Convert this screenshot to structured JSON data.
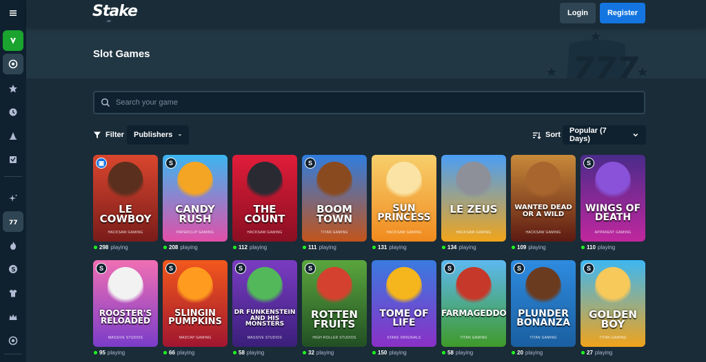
{
  "header": {
    "logo": "Stake",
    "logo_sub": ".us",
    "login_label": "Login",
    "register_label": "Register"
  },
  "sidebar": {
    "items": [
      {
        "icon": "menu-icon"
      },
      {
        "icon": "sweepstakes-icon"
      },
      {
        "icon": "casino-chip-icon"
      },
      {
        "icon": "star-icon"
      },
      {
        "icon": "clock-icon"
      },
      {
        "icon": "trophy-cone-icon"
      },
      {
        "icon": "checklist-icon"
      },
      {
        "icon": "sparkle-icon"
      },
      {
        "icon": "slots-777-icon"
      },
      {
        "icon": "fire-icon"
      },
      {
        "icon": "stake-originals-icon"
      },
      {
        "icon": "shirt-icon"
      },
      {
        "icon": "crown-icon"
      },
      {
        "icon": "live-casino-icon"
      }
    ]
  },
  "banner": {
    "title": "Slot Games"
  },
  "search": {
    "placeholder": "Search your game"
  },
  "filters": {
    "filter_label": "Filter",
    "publishers_label": "Publishers",
    "sort_label": "Sort",
    "sort_value": "Popular (7 Days)"
  },
  "games": [
    {
      "title": "LE COWBOY",
      "publisher": "HACKSAW GAMING",
      "playing": "298",
      "badge": "lock",
      "bg_top": "#d9462e",
      "bg_bottom": "#7a1c1a",
      "accent": "#5b2f1d",
      "title_size": 15
    },
    {
      "title": "CANDY RUSH",
      "publisher": "PAPERCLIP GAMING",
      "playing": "208",
      "badge": "S",
      "bg_top": "#3cb6f0",
      "bg_bottom": "#e24fa8",
      "accent": "#f5a524",
      "title_size": 15
    },
    {
      "title": "THE COUNT",
      "publisher": "HACKSAW GAMING",
      "playing": "112",
      "badge": "",
      "bg_top": "#e11d3a",
      "bg_bottom": "#8a0f22",
      "accent": "#2a2a33",
      "title_size": 15
    },
    {
      "title": "BOOM TOWN",
      "publisher": "TITAN GAMING",
      "playing": "111",
      "badge": "S",
      "bg_top": "#2f7de0",
      "bg_bottom": "#c2541b",
      "accent": "#8a4a1f",
      "title_size": 15
    },
    {
      "title": "SUN PRINCESS",
      "publisher": "HACKSAW GAMING",
      "playing": "131",
      "badge": "",
      "bg_top": "#f7cf6b",
      "bg_bottom": "#f08a1e",
      "accent": "#fbe3a5",
      "title_size": 14
    },
    {
      "title": "LE ZEUS",
      "publisher": "HACKSAW GAMING",
      "playing": "134",
      "badge": "",
      "bg_top": "#4a9ef5",
      "bg_bottom": "#f1a51a",
      "accent": "#8d8f99",
      "title_size": 15
    },
    {
      "title": "WANTED DEAD OR A WILD",
      "publisher": "HACKSAW GAMING",
      "playing": "109",
      "badge": "",
      "bg_top": "#c88a3a",
      "bg_bottom": "#5d1a12",
      "accent": "#a8652e",
      "title_size": 10
    },
    {
      "title": "WINGS OF DEATH",
      "publisher": "APPARENT GAMING",
      "playing": "110",
      "badge": "S",
      "bg_top": "#4a2b8a",
      "bg_bottom": "#c0279e",
      "accent": "#8a52d8",
      "title_size": 14
    },
    {
      "title": "ROOSTER'S RELOADED",
      "publisher": "MASSIVE STUDIOS",
      "playing": "95",
      "badge": "S",
      "bg_top": "#f06fb3",
      "bg_bottom": "#7b3cc9",
      "accent": "#f2f2f2",
      "title_size": 12
    },
    {
      "title": "SLINGIN PUMPKINS",
      "publisher": "MADCAP GAMING",
      "playing": "66",
      "badge": "S",
      "bg_top": "#f2581c",
      "bg_bottom": "#a01630",
      "accent": "#ff9b1f",
      "title_size": 13
    },
    {
      "title": "DR FUNKENSTEIN AND HIS MONSTERS",
      "publisher": "MASSIVE STUDIOS",
      "playing": "58",
      "badge": "S",
      "bg_top": "#7a3cc2",
      "bg_bottom": "#3a1f7a",
      "accent": "#52b85a",
      "title_size": 9
    },
    {
      "title": "ROTTEN FRUITS",
      "publisher": "HIGH ROLLER STUDIOS",
      "playing": "32",
      "badge": "S",
      "bg_top": "#5aa63d",
      "bg_bottom": "#224f24",
      "accent": "#d4412e",
      "title_size": 15
    },
    {
      "title": "TOME OF LIFE",
      "publisher": "STAKE ORIGINALS",
      "playing": "150",
      "badge": "",
      "bg_top": "#3a7be0",
      "bg_bottom": "#8a30c7",
      "accent": "#f5b51c",
      "title_size": 14
    },
    {
      "title": "FARMAGEDDON",
      "publisher": "TITAN GAMING",
      "playing": "58",
      "badge": "S",
      "bg_top": "#5db9f0",
      "bg_bottom": "#3f9a2a",
      "accent": "#c6382a",
      "title_size": 12
    },
    {
      "title": "PLUNDER BONANZA",
      "publisher": "TITAN GAMING",
      "playing": "20",
      "badge": "S",
      "bg_top": "#2e8be0",
      "bg_bottom": "#1a5fa0",
      "accent": "#6b3b1f",
      "title_size": 14
    },
    {
      "title": "GOLDEN BOY",
      "publisher": "TITAN GAMING",
      "playing": "27",
      "badge": "S",
      "bg_top": "#3db7f2",
      "bg_bottom": "#f0a31c",
      "accent": "#f7c85a",
      "title_size": 15
    }
  ],
  "playing_suffix": "playing",
  "colors": {
    "bg": "#1a2c38",
    "sidebar": "#0f212e",
    "register": "#1475e1",
    "online_dot": "#1fff20"
  }
}
